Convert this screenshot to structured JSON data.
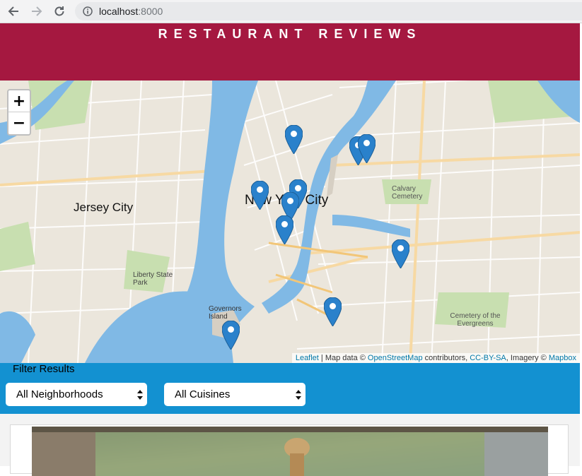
{
  "browser": {
    "url_host": "localhost",
    "url_port": ":8000",
    "icons": [
      "back-arrow-icon",
      "forward-arrow-icon",
      "reload-icon",
      "info-icon"
    ]
  },
  "header": {
    "title": "RESTAURANT REVIEWS"
  },
  "map": {
    "zoom_in_label": "+",
    "zoom_out_label": "−",
    "labels": {
      "jersey_city": "Jersey City",
      "new_york_city": "New York City",
      "calvary_cemetery": "Calvary Cemetery",
      "liberty_state_park": "Liberty State Park",
      "governors_island": "Governors Island",
      "evergreens": "Cemetery of the Evergreens"
    },
    "attribution": {
      "leaflet": "Leaflet",
      "map_data": " | Map data © ",
      "osm": "OpenStreetMap",
      "contributors": " contributors, ",
      "license": "CC-BY-SA",
      "imagery": ", Imagery © ",
      "mapbox": "Mapbox"
    },
    "marker_count": 11
  },
  "filter": {
    "title": "Filter Results",
    "neighborhoods_selected": "All Neighborhoods",
    "cuisines_selected": "All Cuisines"
  },
  "colors": {
    "header_bg": "#a51840",
    "filter_bg": "#1391d1",
    "marker": "#2a81cb",
    "water": "#7fb8e6"
  }
}
